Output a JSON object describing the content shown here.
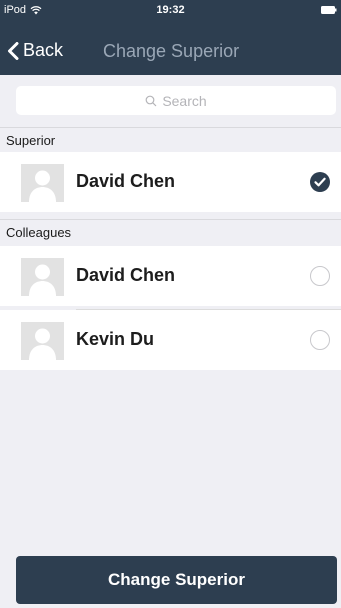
{
  "status_bar": {
    "device": "iPod",
    "time": "19:32"
  },
  "nav": {
    "back_label": "Back",
    "title": "Change Superior"
  },
  "search": {
    "placeholder": "Search"
  },
  "sections": {
    "superior": {
      "title": "Superior",
      "items": [
        {
          "name": "David Chen",
          "selected": true
        }
      ]
    },
    "colleagues": {
      "title": "Colleagues",
      "items": [
        {
          "name": "David Chen",
          "selected": false
        },
        {
          "name": "Kevin Du",
          "selected": false
        }
      ]
    }
  },
  "action": {
    "button_label": "Change Superior"
  },
  "colors": {
    "primary": "#2d3e50",
    "background": "#efeff4",
    "nav_title_muted": "#9aa7b6"
  }
}
